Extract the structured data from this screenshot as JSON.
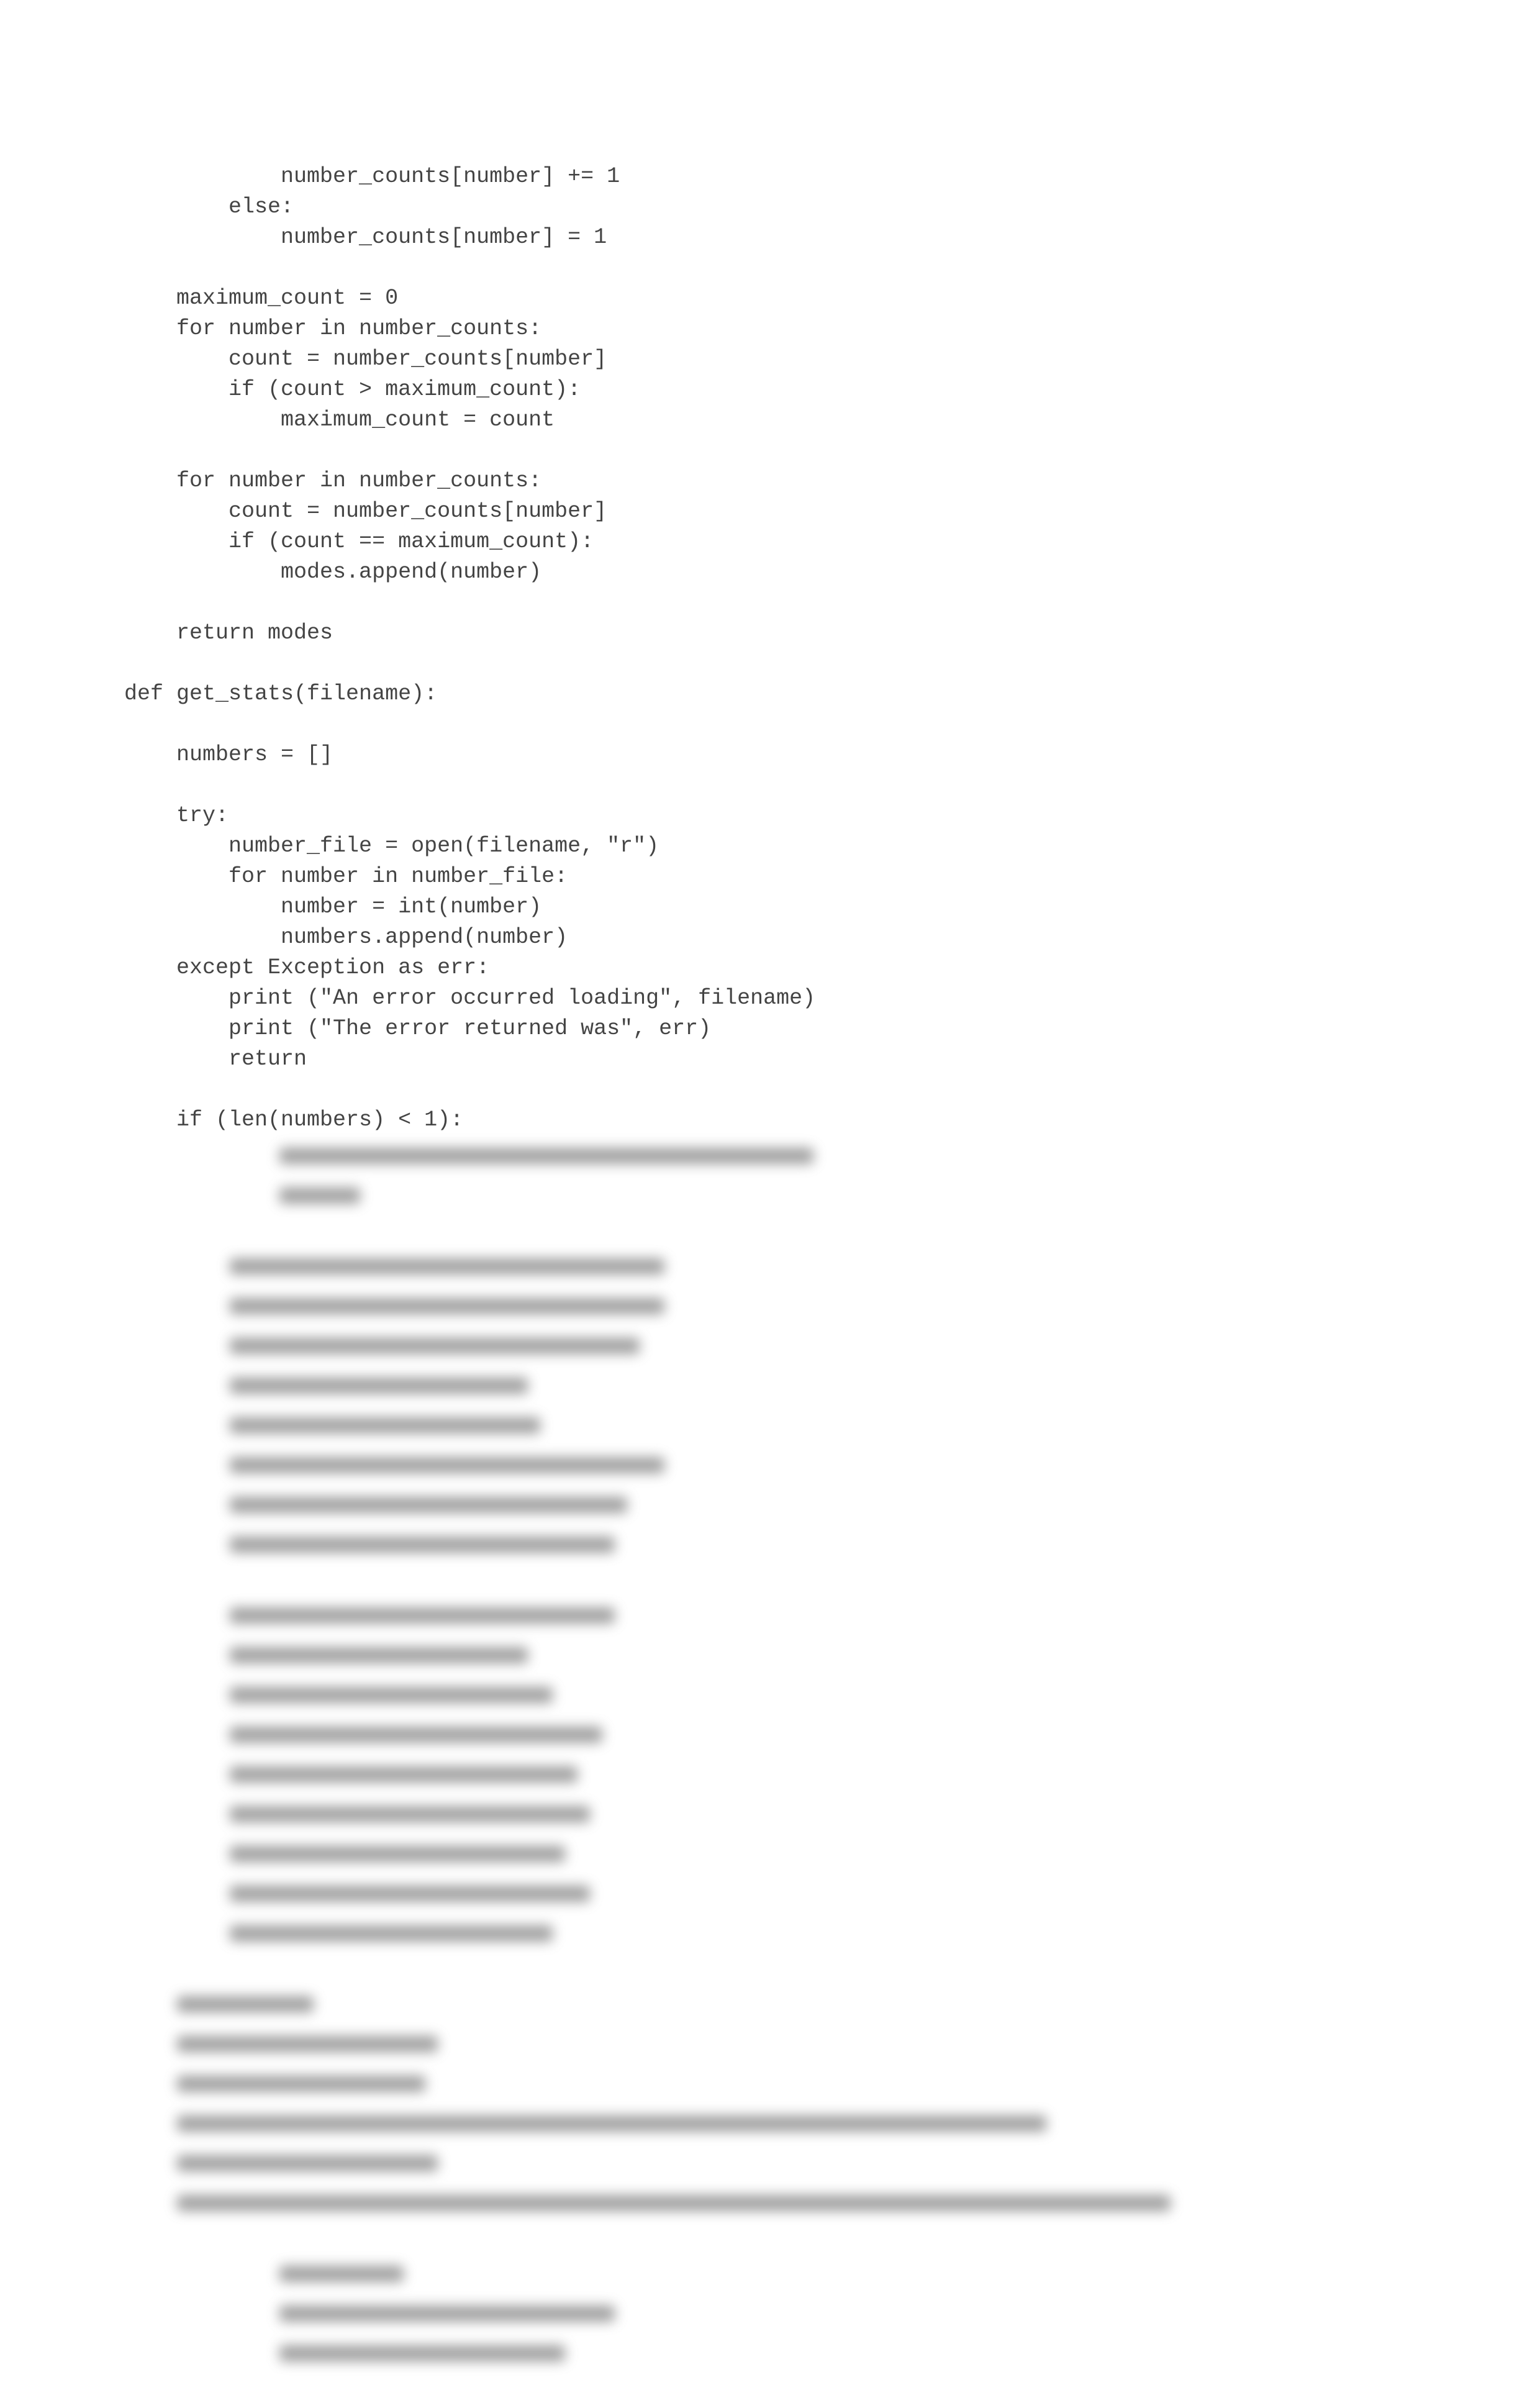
{
  "code_lines": [
    "            number_counts[number] += 1",
    "        else:",
    "            number_counts[number] = 1",
    "",
    "    maximum_count = 0",
    "    for number in number_counts:",
    "        count = number_counts[number]",
    "        if (count > maximum_count):",
    "            maximum_count = count",
    "",
    "    for number in number_counts:",
    "        count = number_counts[number]",
    "        if (count == maximum_count):",
    "            modes.append(number)",
    "",
    "    return modes",
    "",
    "def get_stats(filename):",
    "",
    "    numbers = []",
    "",
    "    try:",
    "        number_file = open(filename, \"r\")",
    "        for number in number_file:",
    "            number = int(number)",
    "            numbers.append(number)",
    "    except Exception as err:",
    "        print (\"An error occurred loading\", filename)",
    "        print (\"The error returned was\", err)",
    "        return",
    "",
    "    if (len(numbers) < 1):"
  ],
  "blurred_blocks": [
    {
      "indent": 250,
      "widths": [
        860,
        130
      ]
    },
    {
      "indent": 170,
      "widths": [
        700,
        700,
        660,
        480,
        500,
        700,
        640,
        620
      ]
    },
    {
      "indent": 170,
      "widths": [
        620,
        480,
        520,
        600,
        560,
        580,
        540,
        580,
        520
      ]
    },
    {
      "indent": 85,
      "widths": [
        220,
        420,
        400,
        1400,
        420,
        1600
      ]
    },
    {
      "indent": 250,
      "widths": [
        200,
        540,
        460
      ]
    }
  ]
}
